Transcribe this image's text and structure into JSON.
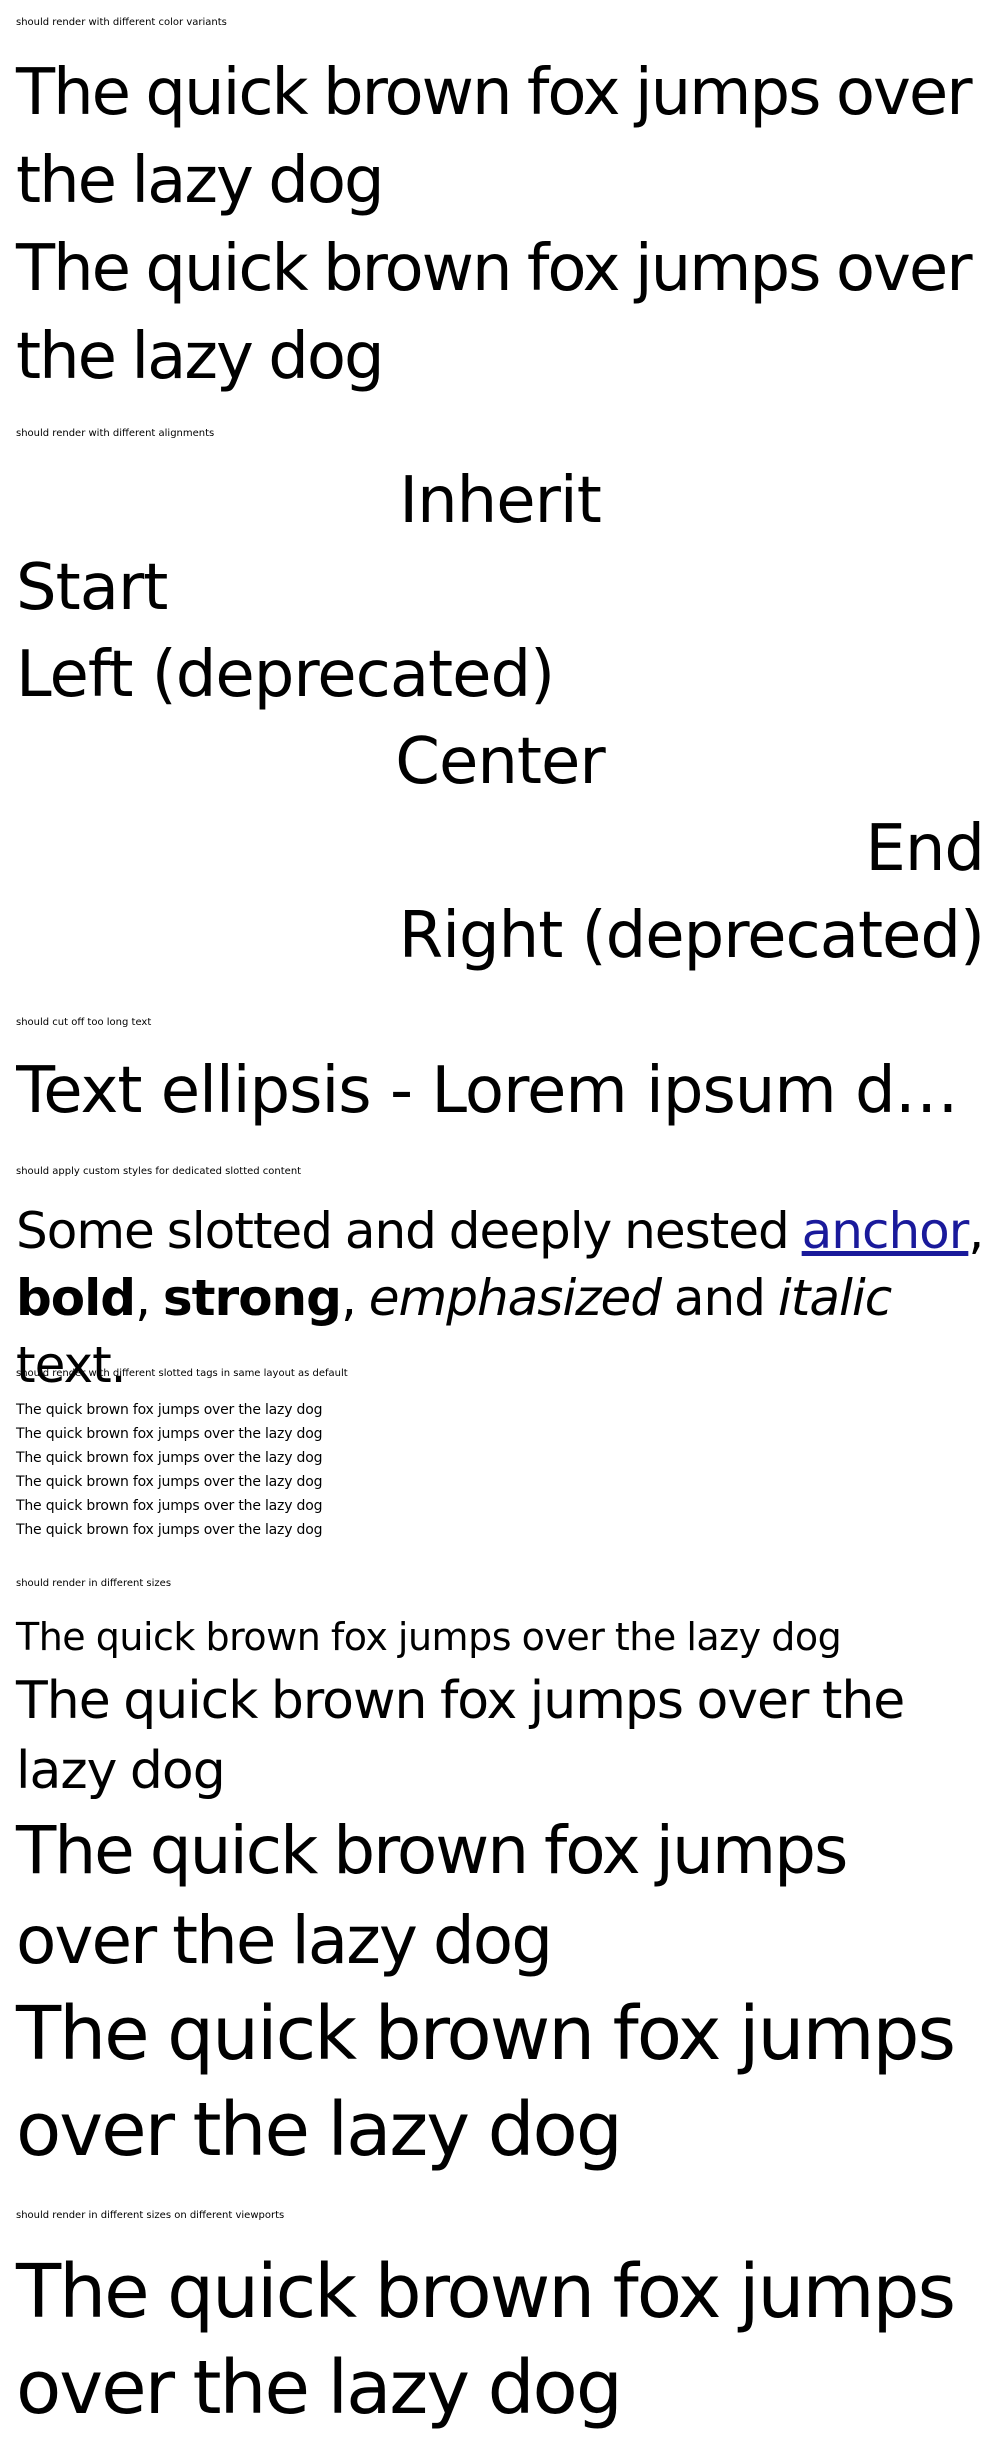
{
  "sections": {
    "color_variants": {
      "caption": "should render with different color variants",
      "lines": [
        "The quick brown fox jumps over the lazy dog",
        "The quick brown fox jumps over the lazy dog"
      ]
    },
    "alignments": {
      "caption": "should render with different alignments",
      "items": [
        {
          "label": "Inherit",
          "align": "center"
        },
        {
          "label": "Start",
          "align": "left"
        },
        {
          "label": "Left (deprecated)",
          "align": "left"
        },
        {
          "label": "Center",
          "align": "center"
        },
        {
          "label": "End",
          "align": "right"
        },
        {
          "label": "Right (deprecated)",
          "align": "right"
        }
      ]
    },
    "ellipsis": {
      "caption": "should cut off too long text",
      "text": "Text ellipsis - Lorem ipsum dolor sit amet, consetetur sadipscing elitr"
    },
    "slotted": {
      "caption": "should apply custom styles for dedicated slotted content",
      "intro": "Some slotted and deeply nested ",
      "anchor": "anchor",
      "comma1": ",",
      "bold": "bold",
      "comma2": ", ",
      "strong": "strong",
      "comma3": ", ",
      "emphasized": "emphasized",
      "and": " and ",
      "italic": "italic",
      "outro": " text."
    },
    "slotted_tags": {
      "caption": "should render with different slotted tags in same layout as default",
      "lines": [
        "The quick brown fox jumps over the lazy dog",
        "The quick brown fox jumps over the lazy dog",
        "The quick brown fox jumps over the lazy dog",
        "The quick brown fox jumps over the lazy dog",
        "The quick brown fox jumps over the lazy dog",
        "The quick brown fox jumps over the lazy dog"
      ]
    },
    "sizes": {
      "caption": "should render in different sizes",
      "lines": [
        "The quick brown fox jumps over the lazy dog",
        "The quick brown fox jumps over the lazy dog",
        "The quick brown fox jumps over the lazy dog",
        "The quick brown fox jumps over the lazy dog"
      ]
    },
    "viewports": {
      "caption": "should render in different sizes on different viewports",
      "text": "The quick brown fox jumps over the lazy dog"
    }
  },
  "colors": {
    "text": "#000000",
    "link": "#1a1a9b",
    "background": "#ffffff"
  }
}
